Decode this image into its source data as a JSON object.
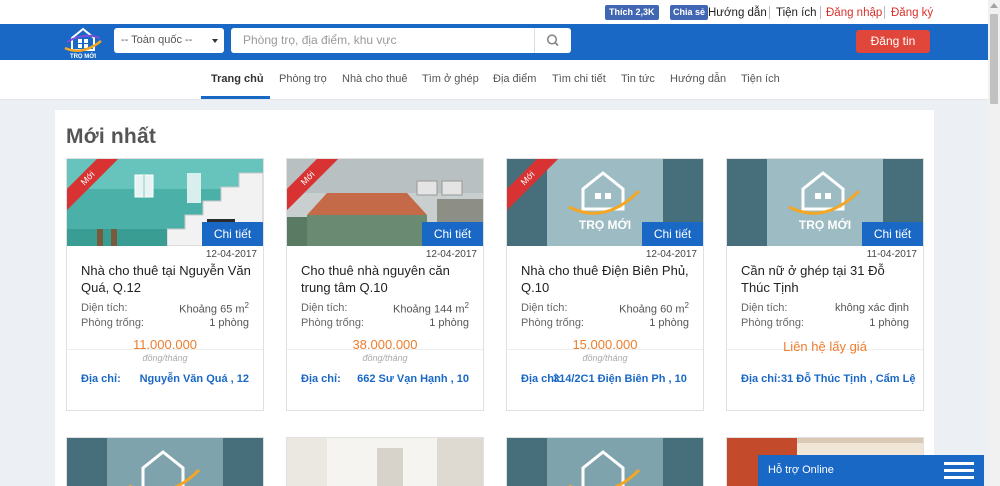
{
  "topbar": {
    "fb_like": "Thích 2,3K",
    "fb_share": "Chia sẻ",
    "links": [
      "Hướng dẫn",
      "Tiện ích",
      "Đăng nhập",
      "Đăng ký"
    ]
  },
  "header": {
    "logo_text": "TRỌ MỚI",
    "region_select": "-- Toàn quốc --",
    "search_placeholder": "Phòng trọ, địa điểm, khu vực",
    "post_button": "Đăng tin"
  },
  "nav": {
    "items": [
      "Trang chủ",
      "Phòng trọ",
      "Nhà cho thuê",
      "Tìm ở ghép",
      "Địa điểm",
      "Tìm chi tiết",
      "Tin tức",
      "Hướng dẫn",
      "Tiện ích"
    ],
    "active": "Trang chủ"
  },
  "section": {
    "title": "Mới nhất"
  },
  "card_labels": {
    "ribbon": "Mới",
    "detail_button": "Chi tiết",
    "area_label": "Diện tích:",
    "rooms_label": "Phòng trống:",
    "price_unit": "đồng/tháng",
    "address_label": "Địa chỉ:"
  },
  "listings": [
    {
      "date": "12-04-2017",
      "title": "Nhà cho thuê tại Nguyễn Văn Quá, Q.12",
      "area": "Khoảng 65 m",
      "area_sup": "2",
      "rooms": "1 phòng",
      "price": "11.000.000",
      "address": "Nguyễn Văn Quá , 12",
      "ribbon": true,
      "thumb": "photo-stairs"
    },
    {
      "date": "12-04-2017",
      "title": "Cho thuê nhà nguyên căn trung tâm Q.10",
      "area": "Khoảng 144 m",
      "area_sup": "2",
      "rooms": "1 phòng",
      "price": "38.000.000",
      "address": "662 Sư Vạn Hạnh , 10",
      "ribbon": true,
      "thumb": "photo-house"
    },
    {
      "date": "12-04-2017",
      "title": "Nhà cho thuê Điện Biên Phủ, Q.10",
      "area": "Khoảng 60 m",
      "area_sup": "2",
      "rooms": "1 phòng",
      "price": "15.000.000",
      "address": "314/2C1 Điện Biên Ph , 10",
      "address_inline": true,
      "ribbon": true,
      "thumb": "logo"
    },
    {
      "date": "11-04-2017",
      "title": "Cần nữ ở ghép tại 31 Đỗ Thúc Tịnh",
      "area": "không xác định",
      "area_sup": "",
      "rooms": "1 phòng",
      "price": "Liên hệ lấy giá",
      "address": "31 Đỗ Thúc Tịnh , Cẩm Lệ",
      "address_inline": true,
      "ribbon": false,
      "thumb": "logo"
    }
  ],
  "support": {
    "label": "Hỗ trợ Online"
  },
  "colors": {
    "brand_blue": "#1a68c6",
    "accent_red": "#e0473a",
    "price_orange": "#ef7d2e"
  }
}
